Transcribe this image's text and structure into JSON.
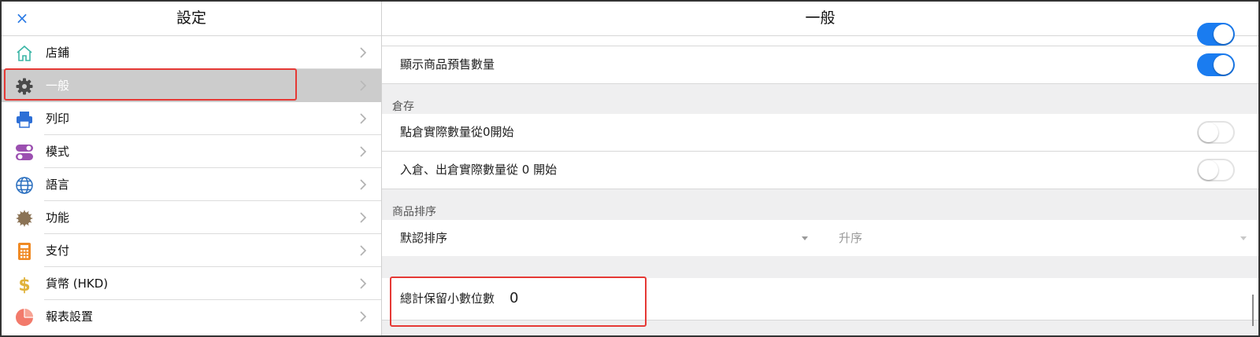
{
  "settings": {
    "title": "設定",
    "close_label": "×",
    "menu": [
      {
        "label": "店鋪",
        "icon": "home-icon"
      },
      {
        "label": "一般",
        "icon": "gear-icon",
        "active": true
      },
      {
        "label": "列印",
        "icon": "printer-icon"
      },
      {
        "label": "模式",
        "icon": "mode-toggle-icon"
      },
      {
        "label": "語言",
        "icon": "globe-icon"
      },
      {
        "label": "功能",
        "icon": "function-gear-icon"
      },
      {
        "label": "支付",
        "icon": "calculator-icon"
      },
      {
        "label": "貨幣 (HKD)",
        "icon": "dollar-icon"
      },
      {
        "label": "報表設置",
        "icon": "pie-chart-icon"
      }
    ]
  },
  "general": {
    "title": "一般",
    "presale_qty": {
      "label": "顯示商品預售數量",
      "on": true
    },
    "inventory_section": "倉存",
    "stocktake_zero": {
      "label": "點倉實際數量從0開始",
      "on": false
    },
    "inout_zero": {
      "label": "入倉、出倉實際數量從 0 開始",
      "on": false
    },
    "sort_section": "商品排序",
    "sort_field": "默認排序",
    "sort_order": "升序",
    "decimal_label": "總計保留小數位數",
    "decimal_value": "0"
  },
  "colors": {
    "accent": "#1a7cf0",
    "highlight": "#e53935",
    "active_row": "#cccccc"
  }
}
